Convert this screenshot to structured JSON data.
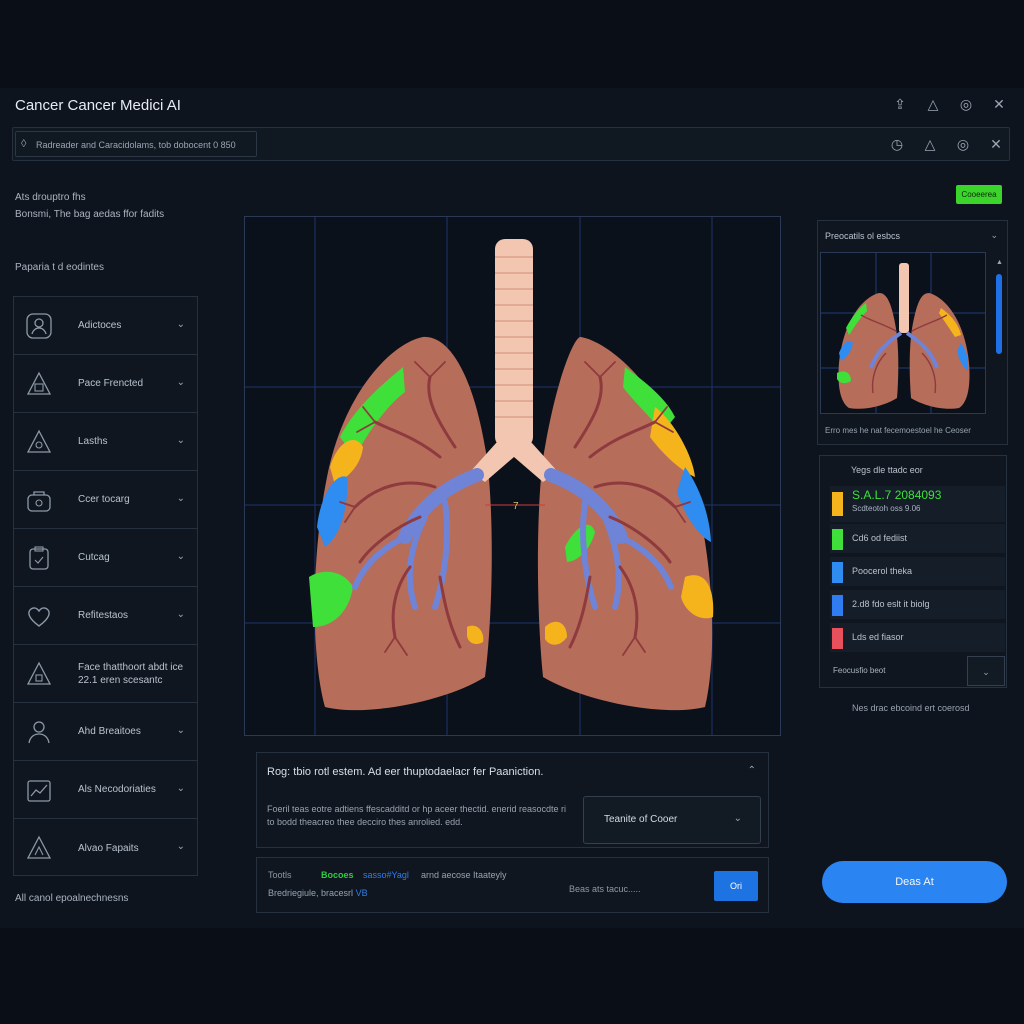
{
  "app": {
    "title": "Cancer Cancer Medici AI"
  },
  "window_icons": [
    "export-icon",
    "image-icon",
    "record-icon",
    "close-icon"
  ],
  "toolbar": {
    "search_text": "Radreader and Caracidolams, tob dobocent 0 850",
    "icons": [
      "timer-icon",
      "image-icon",
      "record-icon",
      "close-icon"
    ]
  },
  "intro": {
    "line1": "Ats drouptro fhs",
    "line2": "Bonsmi, The bag aedas ffor fadits",
    "line3": "Paparia t d eodintes"
  },
  "sidebar": {
    "items": [
      {
        "icon": "person-icon",
        "label": "Adictoces"
      },
      {
        "icon": "warning-icon",
        "label": "Pace Frencted"
      },
      {
        "icon": "warning-icon",
        "label": "Lasths"
      },
      {
        "icon": "bag-icon",
        "label": "Ccer tocarg"
      },
      {
        "icon": "clipboard-icon",
        "label": "Cutcag"
      },
      {
        "icon": "heart-icon",
        "label": "Refitestaos"
      },
      {
        "icon": "warning-icon",
        "label": "Face thatthoort abdt ice",
        "sublabel": "22.1 eren scesantc"
      },
      {
        "icon": "person-icon",
        "label": "Ahd Breaitoes"
      },
      {
        "icon": "chart-icon",
        "label": "Als Necodoriaties"
      },
      {
        "icon": "warning-icon",
        "label": "Alvao Fapaits"
      }
    ],
    "footer": "All canol epoalnechnesns"
  },
  "viewport": {
    "marker": "7"
  },
  "panel": {
    "title": "Rog: tbio rotl estem. Ad eer thuptodaelacr fer Paaniction.",
    "desc": "Foeril teas eotre adtiens ffescadditd or hp aceer thectid. enerid reasocdte ri to bodd theacreo thee decciro thes anrolied. edd.",
    "select": "Teanite of Cooer"
  },
  "bottom_bar": {
    "label": "Tootls",
    "green_text": "Bocoes",
    "blue_text": "sasso#Yagl",
    "rest_text": "arnd aecose Itaateyly",
    "line2": "Bredriegiule, bracesrl",
    "line2_accent": "VB",
    "input_placeholder": "Beas ats tacuc.....",
    "button": "Ori"
  },
  "right": {
    "status_badge": "Cooeerea",
    "preview_title": "Preocatils ol esbcs",
    "preview_caption": "Erro mes he nat fecemoestoel he Ceoser",
    "legend_title": "Yegs dle ttadc eor",
    "legend": [
      {
        "color": "#f5b41c",
        "value": "S.A.L.7 2084093",
        "sub": "Scdteotoh oss  9.06"
      },
      {
        "color": "#3fe03a",
        "label": "Cd6 od fediist"
      },
      {
        "color": "#2f8cf0",
        "label": "Poocerol theka"
      },
      {
        "color": "#2f7df0",
        "label": "2.d8 fdo eslt it biolg"
      },
      {
        "color": "#e8505b",
        "label": "Lds ed fiasor"
      }
    ],
    "legend_footer": "Feocusfio beot",
    "note": "Nes drac ebcoind ert coerosd",
    "cta": "Deas At"
  },
  "colors": {
    "accent": "#2a84f2",
    "success": "#3bd42b",
    "tumor_green": "#3fe03a",
    "tumor_yellow": "#f5b41c",
    "tumor_blue": "#2f8cf0"
  }
}
